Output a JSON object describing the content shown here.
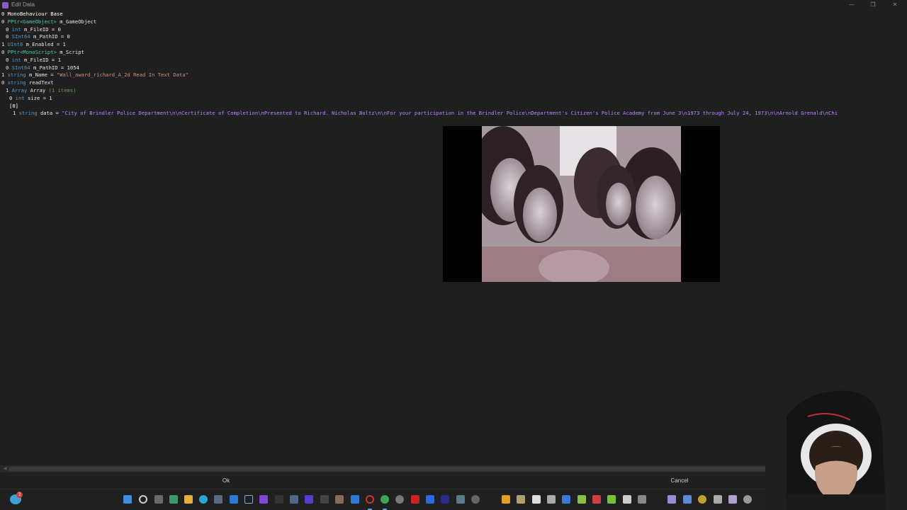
{
  "window": {
    "title": "Edit Data",
    "controls": {
      "minimize": "—",
      "maximize": "❐",
      "close": "✕"
    }
  },
  "tree": {
    "root": "0 MonoBehaviour Base",
    "rows": [
      {
        "num": "0",
        "type": "PPtr<GameObject>",
        "field": "m_GameObject",
        "value": "",
        "indent": 0,
        "ptr": true
      },
      {
        "num": "0",
        "type": "int",
        "field": "m_FileID",
        "value": "= 0",
        "indent": 1
      },
      {
        "num": "0",
        "type": "SInt64",
        "field": "m_PathID",
        "value": "= 0",
        "indent": 1
      },
      {
        "num": "1",
        "type": "UInt8",
        "field": "m_Enabled",
        "value": "= 1",
        "indent": 0
      },
      {
        "num": "0",
        "type": "PPtr<MonoScript>",
        "field": "m_Script",
        "value": "",
        "indent": 0,
        "ptr": true
      },
      {
        "num": "0",
        "type": "int",
        "field": "m_FileID",
        "value": "= 1",
        "indent": 1
      },
      {
        "num": "0",
        "type": "SInt64",
        "field": "m_PathID",
        "value": "= 1054",
        "indent": 1
      }
    ],
    "name_row": {
      "num": "1",
      "type": "string",
      "field": "m_Name",
      "eq": "=",
      "value": "\"Wall_award_richard_A_2d Read In Text Data\""
    },
    "readtext_row": {
      "num": "0",
      "type": "string",
      "field": "readText"
    },
    "array_row": {
      "num": "1",
      "type": "Array",
      "field": "Array",
      "extra": "(1 items)"
    },
    "size_row": {
      "num": "0",
      "type": "int",
      "field": "size",
      "value": "= 1"
    },
    "index_row": "[0]",
    "data_row": {
      "num": "1",
      "type": "string",
      "field": "data",
      "eq": "=",
      "value": "\"City of Brindler Police Department\\n\\nCertificate of Completion\\nPresented to Richard. Nicholas Boltz\\n\\nFor your participation in the Brindler Police\\nDepartment's Citizen's Police Academy from June 3\\n1973 through July 24, 1973\\n\\nArnold Grenald\\nChi"
    }
  },
  "buttons": {
    "ok": "Ok",
    "cancel": "Cancel"
  },
  "taskbar": {
    "notification_count": "3"
  },
  "colors": {
    "background": "#1f1f1f",
    "type": "#4f9ad6",
    "string": "#ce9178",
    "data_string": "#b48cff"
  }
}
